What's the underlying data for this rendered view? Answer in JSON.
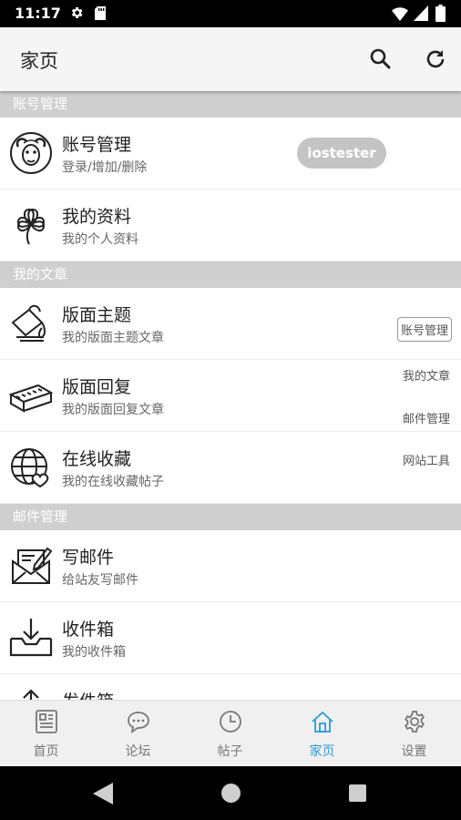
{
  "status_bar": {
    "time": "11:17"
  },
  "app_bar": {
    "title": "家页"
  },
  "sections": [
    {
      "header": "账号管理",
      "rows": [
        {
          "title": "账号管理",
          "subtitle": "登录/增加/删除",
          "icon": "ram-icon",
          "badge": "iostester"
        },
        {
          "title": "我的资料",
          "subtitle": "我的个人资料",
          "icon": "clover-icon"
        }
      ]
    },
    {
      "header": "我的文章",
      "rows": [
        {
          "title": "版面主题",
          "subtitle": "我的版面主题文章",
          "icon": "paint-bucket-icon"
        },
        {
          "title": "版面回复",
          "subtitle": "我的版面回复文章",
          "icon": "brick-icon"
        },
        {
          "title": "在线收藏",
          "subtitle": "我的在线收藏帖子",
          "icon": "globe-heart-icon"
        }
      ]
    },
    {
      "header": "邮件管理",
      "rows": [
        {
          "title": "写邮件",
          "subtitle": "给站友写邮件",
          "icon": "write-mail-icon"
        },
        {
          "title": "收件箱",
          "subtitle": "我的收件箱",
          "icon": "inbox-icon"
        },
        {
          "title": "发件箱",
          "subtitle": "",
          "icon": "outbox-icon"
        }
      ]
    }
  ],
  "quick_nav": [
    "账号管理",
    "我的文章",
    "邮件管理",
    "网站工具"
  ],
  "bottom_nav": {
    "tabs": [
      {
        "label": "首页",
        "icon": "newspaper-icon"
      },
      {
        "label": "论坛",
        "icon": "chat-bubble-icon"
      },
      {
        "label": "帖子",
        "icon": "clock-icon"
      },
      {
        "label": "家页",
        "icon": "home-icon",
        "active": true
      },
      {
        "label": "设置",
        "icon": "gear-icon"
      }
    ]
  },
  "colors": {
    "active_tab": "#2a9bd8",
    "section_header": "#cfcfcf",
    "badge": "#c4c4c4"
  }
}
